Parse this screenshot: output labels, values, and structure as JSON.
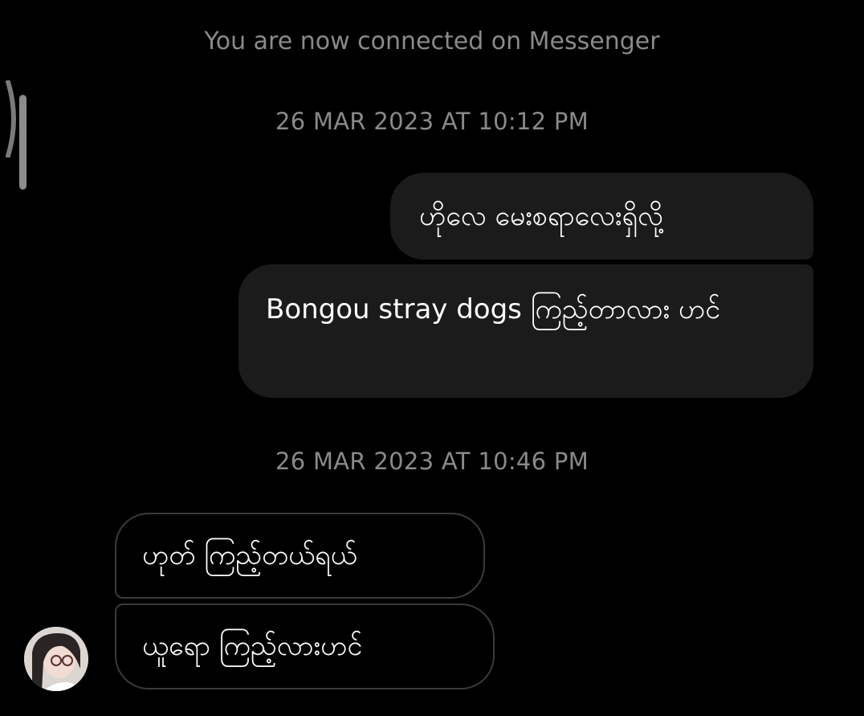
{
  "thread": {
    "system_note": "You are now connected on Messenger",
    "timestamps": [
      "26 MAR 2023 AT 10:12 PM",
      "26 MAR 2023 AT 10:46 PM"
    ],
    "messages": [
      {
        "direction": "sent",
        "text": "ဟိုလေ မေးစရာလေးရှိလို့"
      },
      {
        "direction": "sent",
        "text": "Bongou stray dogs ကြည့်တာလား ဟင်"
      },
      {
        "direction": "received",
        "text": "ဟုတ် ကြည့်တယ်ရယ်"
      },
      {
        "direction": "received",
        "text": "ယူရော ကြည့်လားဟင်"
      }
    ]
  },
  "colors": {
    "background": "#000000",
    "sent_bubble": "#1b1b1b",
    "received_border": "#3a3a3a",
    "meta_text": "#8a8a8a"
  }
}
